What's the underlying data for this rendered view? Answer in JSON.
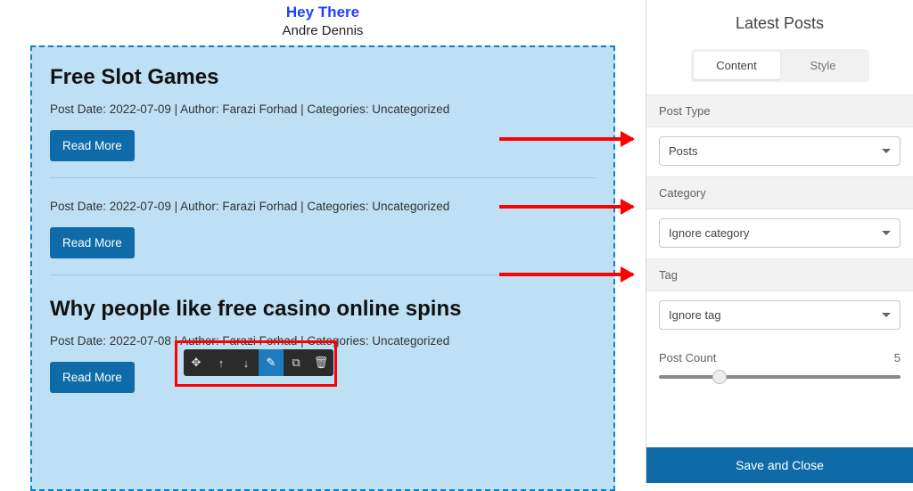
{
  "header": {
    "title": "Hey There",
    "author": "Andre Dennis"
  },
  "posts": [
    {
      "title": "Free Slot Games",
      "meta": "Post Date: 2022-07-09 | Author: Farazi Forhad | Categories: Uncategorized",
      "read_more": "Read More"
    },
    {
      "title": "",
      "meta": "Post Date: 2022-07-09 | Author: Farazi Forhad | Categories: Uncategorized",
      "read_more": "Read More"
    },
    {
      "title": "Why people like free casino online spins",
      "meta": "Post Date: 2022-07-08 | Author: Farazi Forhad | Categories: Uncategorized",
      "read_more": "Read More"
    }
  ],
  "toolbar": {
    "move": "✥",
    "up": "↑",
    "down": "↓",
    "edit": "✎",
    "copy": "⧉",
    "delete": "🗑"
  },
  "panel": {
    "title": "Latest Posts",
    "tabs": {
      "content": "Content",
      "style": "Style"
    },
    "post_type": {
      "label": "Post Type",
      "value": "Posts"
    },
    "category": {
      "label": "Category",
      "value": "Ignore category"
    },
    "tag": {
      "label": "Tag",
      "value": "Ignore tag"
    },
    "post_count": {
      "label": "Post Count",
      "value": "5"
    },
    "save": "Save and Close"
  }
}
